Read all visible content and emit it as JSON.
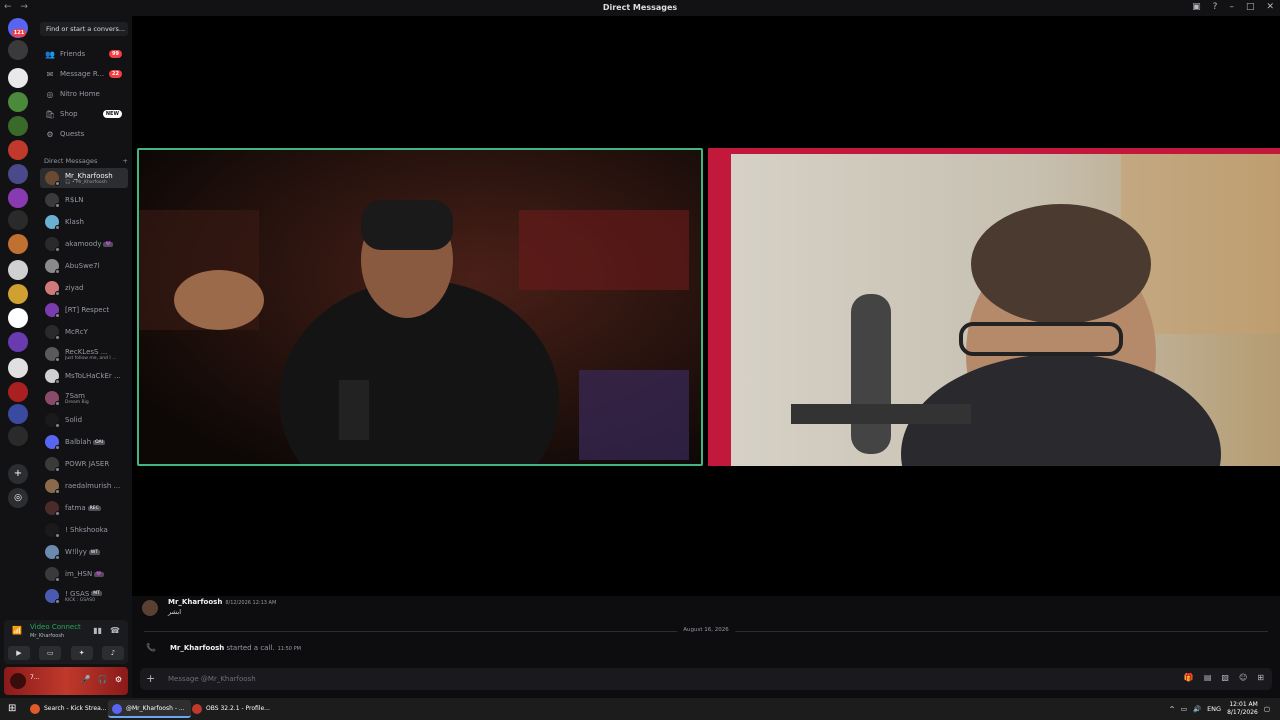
{
  "window": {
    "title": "Direct Messages",
    "nav": "← →"
  },
  "rail": {
    "home_badge": "121",
    "server_colors": [
      "#5865f2",
      "#3a3a3a",
      "#e9e9e9",
      "#4a8a3a",
      "#3a6a2a",
      "#c0392b",
      "#4a4a8a",
      "#8a3ab0",
      "#2a2a2a",
      "#c07030",
      "#d0d0d0",
      "#d0a030",
      "#ffffff",
      "#6a3ab0",
      "#e0e0e0",
      "#aa2020",
      "#3a4aa0",
      "#2a2a2a"
    ]
  },
  "sidebar": {
    "search_placeholder": "Find or start a convers...",
    "nav": [
      {
        "label": "Friends",
        "icon": "friends-icon",
        "glyph": "👥",
        "badge": "99"
      },
      {
        "label": "Message R...",
        "icon": "message-requests-icon",
        "glyph": "✉",
        "badge": "22"
      },
      {
        "label": "Nitro Home",
        "icon": "nitro-icon",
        "glyph": "◎",
        "badge": ""
      },
      {
        "label": "Shop",
        "icon": "shop-icon",
        "glyph": "🛍",
        "badge": "NEW"
      },
      {
        "label": "Quests",
        "icon": "quests-icon",
        "glyph": "⚙",
        "badge": ""
      }
    ],
    "dm_header": "Direct Messages",
    "dm_add": "+",
    "dms": [
      {
        "name": "Mr_Kharfoosh",
        "sub": "🎧 • Mr_Kharfoosh",
        "tag": "",
        "color": "#6a4a30",
        "active": true
      },
      {
        "name": "R$LN",
        "sub": "",
        "tag": "",
        "color": "#3a3a3a"
      },
      {
        "name": "Klash",
        "sub": "",
        "tag": "",
        "color": "#6ab0d0"
      },
      {
        "name": "akamoody",
        "sub": "",
        "tag": "💜",
        "color": "#2a2a2a"
      },
      {
        "name": "AbuSwe7l",
        "sub": "",
        "tag": "",
        "color": "#8a8a8a"
      },
      {
        "name": "ziyad",
        "sub": "",
        "tag": "",
        "color": "#d07a7a"
      },
      {
        "name": "[RT] Respect",
        "sub": "",
        "tag": "",
        "color": "#7a3ab0"
      },
      {
        "name": "McRcY",
        "sub": "",
        "tag": "",
        "color": "#2a2a2a"
      },
      {
        "name": "RecKLesS ...",
        "sub": "Just follow me, and I ...",
        "tag": "",
        "color": "#5a5a5a"
      },
      {
        "name": "MsToLHaCkEr ...",
        "sub": "",
        "tag": "",
        "color": "#d0d0d0"
      },
      {
        "name": "7Sam",
        "sub": "Dream Big",
        "tag": "",
        "color": "#8a4a6a"
      },
      {
        "name": "Solid",
        "sub": "",
        "tag": "",
        "color": "#1a1a1a"
      },
      {
        "name": "Balblah",
        "sub": "",
        "tag": "OAI",
        "color": "#5865f2"
      },
      {
        "name": "POWR JASER",
        "sub": "",
        "tag": "",
        "color": "#3a3a3a"
      },
      {
        "name": "raedalmurish ...",
        "sub": "",
        "tag": "",
        "color": "#8a6a4a"
      },
      {
        "name": "fatma",
        "sub": "",
        "tag": "REC",
        "color": "#4a2a2a"
      },
      {
        "name": "! Shkshooka",
        "sub": "",
        "tag": "",
        "color": "#1a1a1a"
      },
      {
        "name": "W!llyy",
        "sub": "",
        "tag": "WT",
        "color": "#6a8ab0"
      },
      {
        "name": "im_HSN",
        "sub": "",
        "tag": "💜",
        "color": "#3a3a3a"
      },
      {
        "name": "! GSAS",
        "sub": "KICK : GSAS0",
        "tag": "MT",
        "color": "#4a5ab0"
      }
    ]
  },
  "voice": {
    "status": "Video Connect",
    "where": "Mr_Kharfoosh"
  },
  "user": {
    "name": "7..."
  },
  "call": {
    "tile1_name": "",
    "tile2_name": ""
  },
  "chat": {
    "messages": [
      {
        "author": "Mr_Kharfoosh",
        "time": "8/12/2026 12:13 AM",
        "text": "ابشر"
      }
    ],
    "date_divider": "August 16, 2026",
    "call_author": "Mr_Kharfoosh",
    "call_text": " started a call.",
    "call_time": "11:50 PM",
    "composer_placeholder": "Message @Mr_Kharfoosh"
  },
  "taskbar": {
    "apps": [
      {
        "label": "Search - Kick Strea...",
        "color": "#e05a2a",
        "active": false
      },
      {
        "label": "@Mr_Kharfoosh - ...",
        "color": "#5865f2",
        "active": true
      },
      {
        "label": "OBS 32.2.1 - Profile...",
        "color": "#c0392b",
        "active": false
      }
    ],
    "lang": "ENG",
    "time": "12:01 AM",
    "date": "8/17/2026"
  }
}
